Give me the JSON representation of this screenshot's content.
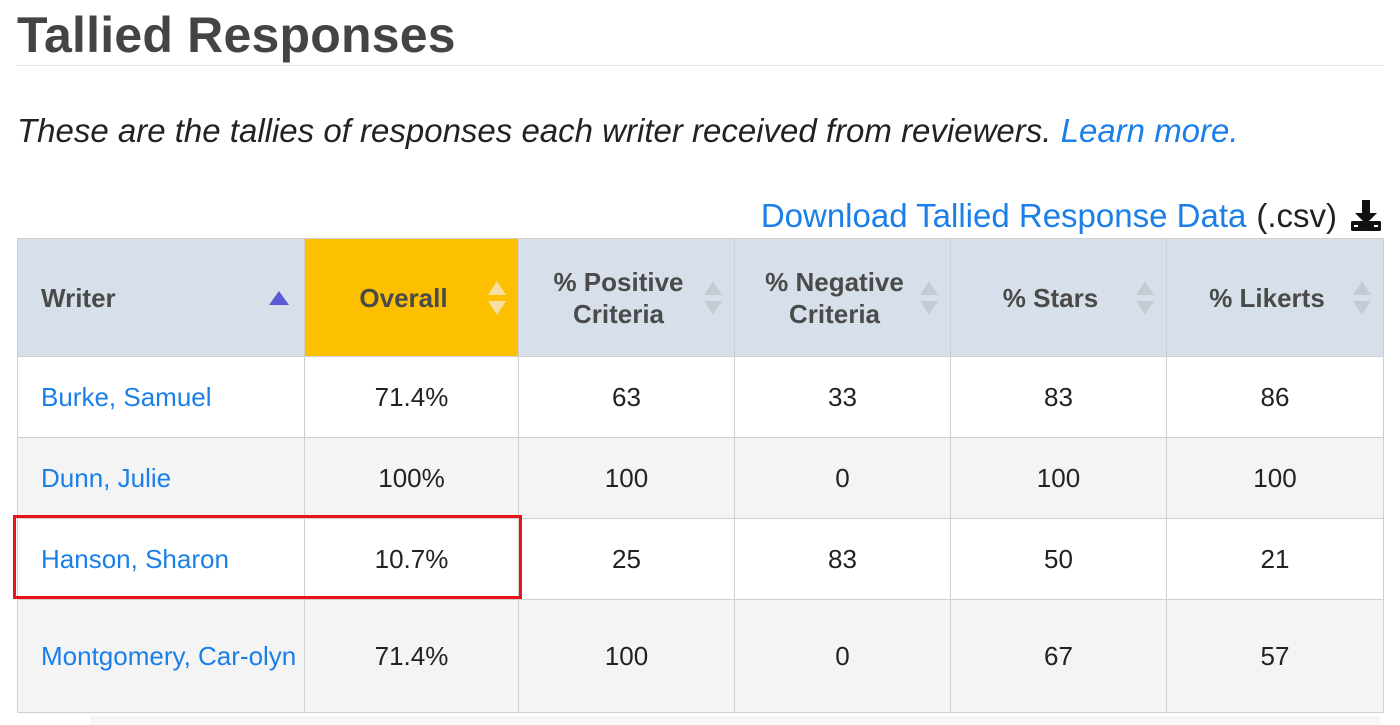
{
  "title": "Tallied Responses",
  "intro": {
    "text": "These are the tallies of responses each writer received from reviewers.",
    "link": "Learn more."
  },
  "download": {
    "link": "Download Tallied Response Data",
    "suffix": "(.csv)",
    "icon": "download-icon"
  },
  "colors": {
    "link": "#1a7fe8",
    "header_bg": "#d7e0ea",
    "active_sort_bg": "#fdc000",
    "highlight": "#e8141b",
    "sort_arrow_active": "#5b5bd6"
  },
  "table": {
    "headers": [
      {
        "label": "Writer",
        "sort": "ascending"
      },
      {
        "label": "Overall",
        "sort": "none",
        "active": true
      },
      {
        "label": "% Positive Criteria",
        "sort": "none"
      },
      {
        "label": "% Negative Criteria",
        "sort": "none"
      },
      {
        "label": "% Stars",
        "sort": "none"
      },
      {
        "label": "% Likerts",
        "sort": "none"
      }
    ],
    "rows": [
      {
        "writer": "Burke, Samuel",
        "overall": "71.4%",
        "positive": "63",
        "negative": "33",
        "stars": "83",
        "likerts": "86"
      },
      {
        "writer": "Dunn, Julie",
        "overall": "100%",
        "positive": "100",
        "negative": "0",
        "stars": "100",
        "likerts": "100"
      },
      {
        "writer": "Hanson, Sharon",
        "overall": "10.7%",
        "positive": "25",
        "negative": "83",
        "stars": "50",
        "likerts": "21",
        "highlighted": true
      },
      {
        "writer": "Montgomery, Car-olyn",
        "overall": "71.4%",
        "positive": "100",
        "negative": "0",
        "stars": "67",
        "likerts": "57"
      }
    ]
  }
}
